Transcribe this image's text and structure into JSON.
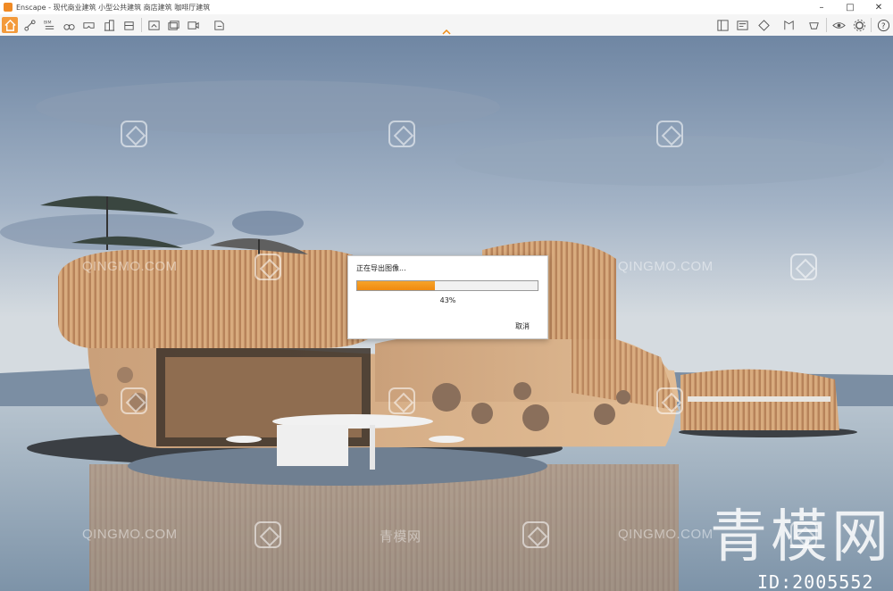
{
  "window": {
    "title": "Enscape - 现代商业建筑 小型公共建筑 商店建筑 咖啡厅建筑",
    "minimize": "–",
    "maximize": "□",
    "close": "✕"
  },
  "toolbar": {
    "left_icons": [
      "home-icon",
      "route-icon",
      "bim-icon",
      "binoculars-icon",
      "vr-icon",
      "building-icon",
      "lightning-icon",
      "screenshot-icon",
      "batch-render-icon",
      "video-icon",
      "export-icon"
    ],
    "right_icons": [
      "asset-library-icon",
      "material-editor-icon",
      "view-management-icon",
      "cube-icon",
      "atlas-icon",
      "settings-group-icon",
      "visual-settings-icon",
      "gear-icon",
      "help-icon"
    ],
    "help_label": "?"
  },
  "dialog": {
    "title": "正在导出图像...",
    "progress": 0.43,
    "percent_label": "43%",
    "cancel_label": "取消"
  },
  "watermark": {
    "text": "QINGMO.COM",
    "cn_text": "青模网",
    "brand": "青模网",
    "id": "ID:2005552"
  },
  "colors": {
    "accent": "#f08a10",
    "sky_top": "#7f93ad",
    "sky_bottom": "#d9dee2",
    "water": "#9fb1c0",
    "wood": "#c99766"
  }
}
